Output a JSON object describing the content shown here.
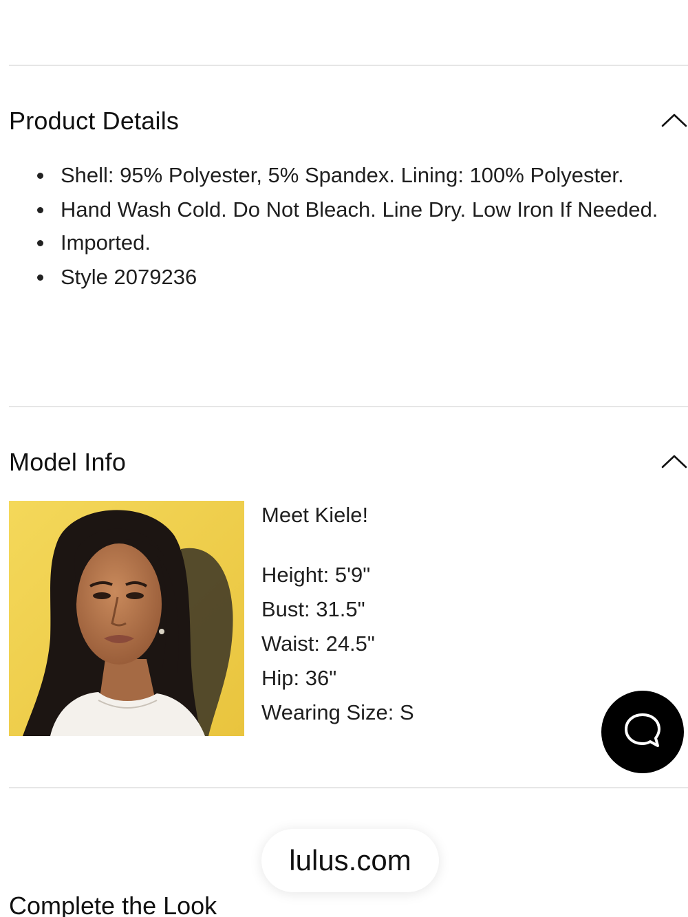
{
  "product_details": {
    "title": "Product Details",
    "items": [
      "Shell: 95% Polyester, 5% Spandex. Lining: 100% Polyester.",
      "Hand Wash Cold. Do Not Bleach. Line Dry. Low Iron If Needed.",
      "Imported.",
      "Style 2079236"
    ],
    "expanded": true
  },
  "model_info": {
    "title": "Model Info",
    "intro": "Meet Kiele!",
    "stats": [
      "Height: 5'9\"",
      "Bust: 31.5\"",
      "Waist: 24.5\"",
      "Hip: 36\"",
      "Wearing Size: S"
    ],
    "expanded": true
  },
  "site_pill": {
    "label": "lulus.com"
  },
  "complete_the_look": {
    "title": "Complete the Look"
  },
  "icons": {
    "section_toggle": "chevron-up-icon",
    "chat": "chat-bubble-icon"
  },
  "colors": {
    "divider": "#e6e6e6",
    "chat_button": "#000000",
    "photo_background": "#f2d24e"
  }
}
